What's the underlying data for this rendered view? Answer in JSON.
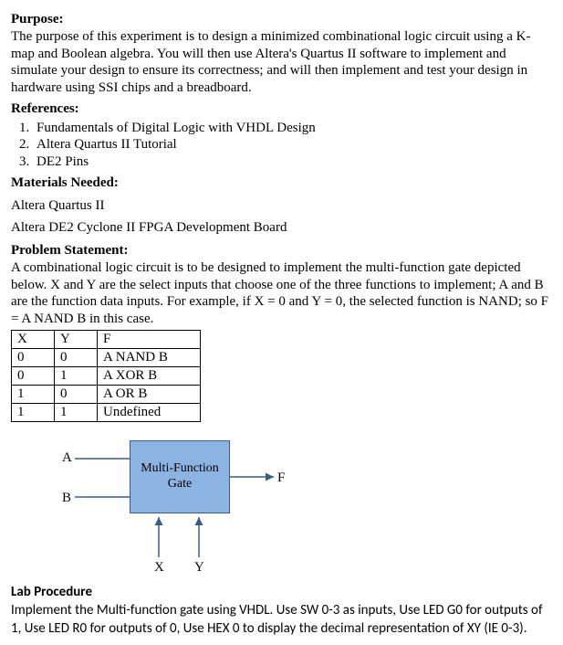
{
  "purpose": {
    "heading": "Purpose:",
    "text": "The purpose of this experiment is to design a minimized combinational logic circuit using a K-map and Boolean algebra. You will then use Altera's Quartus II software to implement and simulate your design to ensure its correctness; and will then implement and test your design in hardware using SSI chips and a breadboard."
  },
  "references": {
    "heading": "References:",
    "items": [
      "Fundamentals of Digital Logic with VHDL Design",
      "Altera Quartus II Tutorial",
      "DE2 Pins"
    ]
  },
  "materials": {
    "heading": "Materials Needed:",
    "items": [
      "Altera Quartus II",
      "Altera DE2 Cyclone II FPGA Development Board"
    ]
  },
  "problem": {
    "heading": "Problem Statement:",
    "text": "A combinational logic circuit is to be designed to implement the multi-function gate depicted below. X and Y are the select inputs that choose one of the three functions to implement; A and B are the function data inputs. For example, if X = 0 and Y = 0, the selected function is NAND; so F = A NAND B in this case."
  },
  "table": {
    "headers": {
      "x": "X",
      "y": "Y",
      "f": "F"
    },
    "rows": [
      {
        "x": "0",
        "y": "0",
        "f": "A NAND B"
      },
      {
        "x": "0",
        "y": "1",
        "f": "A XOR B"
      },
      {
        "x": "1",
        "y": "0",
        "f": "A OR B"
      },
      {
        "x": "1",
        "y": "1",
        "f": "Undefined"
      }
    ]
  },
  "diagram": {
    "a": "A",
    "b": "B",
    "f": "F",
    "x": "X",
    "y": "Y",
    "box_label": "Multi-Function Gate"
  },
  "lab": {
    "heading": "Lab Procedure",
    "text": "Implement the Multi-function gate using VHDL.  Use SW 0-3 as inputs, Use LED G0 for outputs of 1, Use LED R0 for outputs of 0, Use HEX 0 to display the decimal representation of XY (IE 0-3)."
  }
}
